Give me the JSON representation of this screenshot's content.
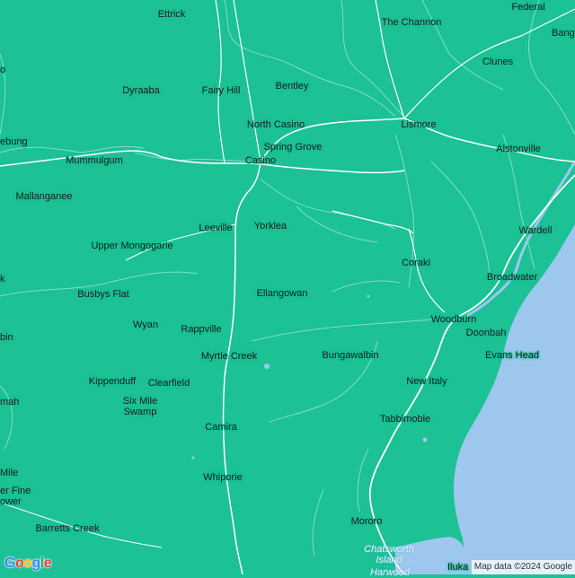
{
  "map": {
    "colors": {
      "land": "#1cc196",
      "water": "#9ec7ee",
      "road": "#ffffff",
      "boundary": "#7fe0c4",
      "river": "#5fd3b1"
    },
    "places": [
      {
        "name": "Ettrick"
      },
      {
        "name": "The Channon"
      },
      {
        "name": "Federal"
      },
      {
        "name": "Banga"
      },
      {
        "name": "Clunes"
      },
      {
        "name": "Dyraaba"
      },
      {
        "name": "Fairy Hill"
      },
      {
        "name": "Bentley"
      },
      {
        "name": "North Casino"
      },
      {
        "name": "Lismore"
      },
      {
        "name": "Spring Grove"
      },
      {
        "name": "Alstonville"
      },
      {
        "name": "Mummulgum"
      },
      {
        "name": "Casino"
      },
      {
        "name": "Mallanganee"
      },
      {
        "name": "Leeville"
      },
      {
        "name": "Yorklea"
      },
      {
        "name": "Wardell"
      },
      {
        "name": "Upper Mongogarie"
      },
      {
        "name": "Coraki"
      },
      {
        "name": "Broadwater"
      },
      {
        "name": "Busbys Flat"
      },
      {
        "name": "Ellangowan"
      },
      {
        "name": "Wyan"
      },
      {
        "name": "Rappville"
      },
      {
        "name": "Woodburn"
      },
      {
        "name": "Doonbah"
      },
      {
        "name": "Myrtle Creek"
      },
      {
        "name": "Bungawalbin"
      },
      {
        "name": "Evans Head"
      },
      {
        "name": "Kippenduff"
      },
      {
        "name": "Clearfield"
      },
      {
        "name": "New Italy"
      },
      {
        "name": "Six Mile Swamp"
      },
      {
        "name": "Tabbimoble"
      },
      {
        "name": "Camira"
      },
      {
        "name": "Whiporie"
      },
      {
        "name": "Mororo"
      },
      {
        "name": "Barretts Creek"
      },
      {
        "name": "Chatsworth Island"
      },
      {
        "name": "Iluka"
      },
      {
        "name": "Harwood"
      },
      {
        "name": "ebung"
      },
      {
        "name": "k"
      },
      {
        "name": "bin"
      },
      {
        "name": "mah"
      },
      {
        "name": "Mile"
      },
      {
        "name": "er Fine"
      },
      {
        "name": "ower"
      },
      {
        "name": "o"
      }
    ]
  },
  "logo": {
    "text": "Google"
  },
  "attribution": {
    "text": "Map data ©2024 Google"
  }
}
